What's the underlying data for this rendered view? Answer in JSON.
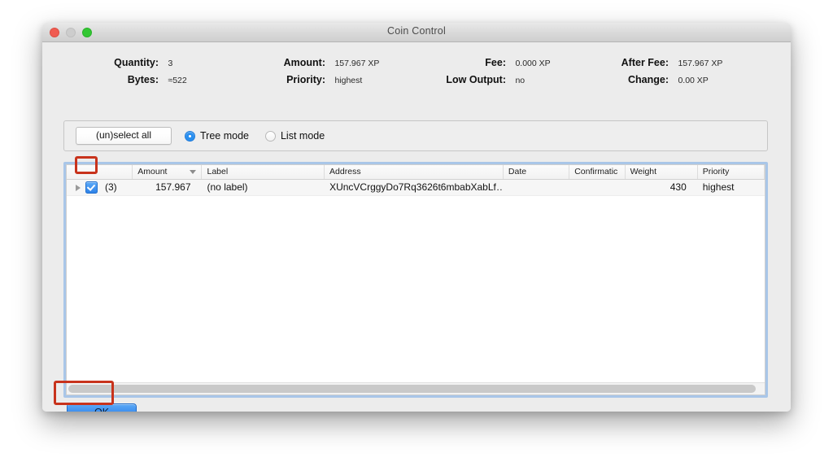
{
  "window": {
    "title": "Coin Control",
    "traffic_lights": [
      "close-light",
      "minimize-light",
      "zoom-light"
    ]
  },
  "stats": {
    "quantity": {
      "label": "Quantity:",
      "value": "3"
    },
    "bytes": {
      "label": "Bytes:",
      "value": "≈522"
    },
    "amount": {
      "label": "Amount:",
      "value": "157.967 XP"
    },
    "priority": {
      "label": "Priority:",
      "value": "highest"
    },
    "fee": {
      "label": "Fee:",
      "value": "0.000 XP"
    },
    "low_output": {
      "label": "Low Output:",
      "value": "no"
    },
    "after_fee": {
      "label": "After Fee:",
      "value": "157.967 XP"
    },
    "change": {
      "label": "Change:",
      "value": "0.00 XP"
    }
  },
  "toolbar": {
    "unselect_all_label": "(un)select all",
    "modes": [
      {
        "label": "Tree mode",
        "selected": true
      },
      {
        "label": "List mode",
        "selected": false
      }
    ]
  },
  "table": {
    "columns": [
      {
        "key": "select",
        "label": ""
      },
      {
        "key": "amount",
        "label": "Amount",
        "sorted": true,
        "sort_direction": "desc"
      },
      {
        "key": "label",
        "label": "Label"
      },
      {
        "key": "address",
        "label": "Address"
      },
      {
        "key": "date",
        "label": "Date"
      },
      {
        "key": "confirmations",
        "label": "Confirmatic"
      },
      {
        "key": "weight",
        "label": "Weight"
      },
      {
        "key": "priority",
        "label": "Priority"
      }
    ],
    "rows": [
      {
        "checked": true,
        "expandable": true,
        "count": "(3)",
        "amount": "157.967",
        "label": "(no label)",
        "address": "XUncVCrggyDo7Rq3626t6mbabXabLf…",
        "date": "",
        "confirmations": "",
        "weight": "430",
        "priority": "highest"
      }
    ]
  },
  "footer": {
    "ok_label": "OK"
  },
  "colors": {
    "accent_blue": "#2a8fef",
    "focus_ring": "#a9c6e8",
    "annotation_red": "#c8331c",
    "window_bg": "#ececec"
  }
}
